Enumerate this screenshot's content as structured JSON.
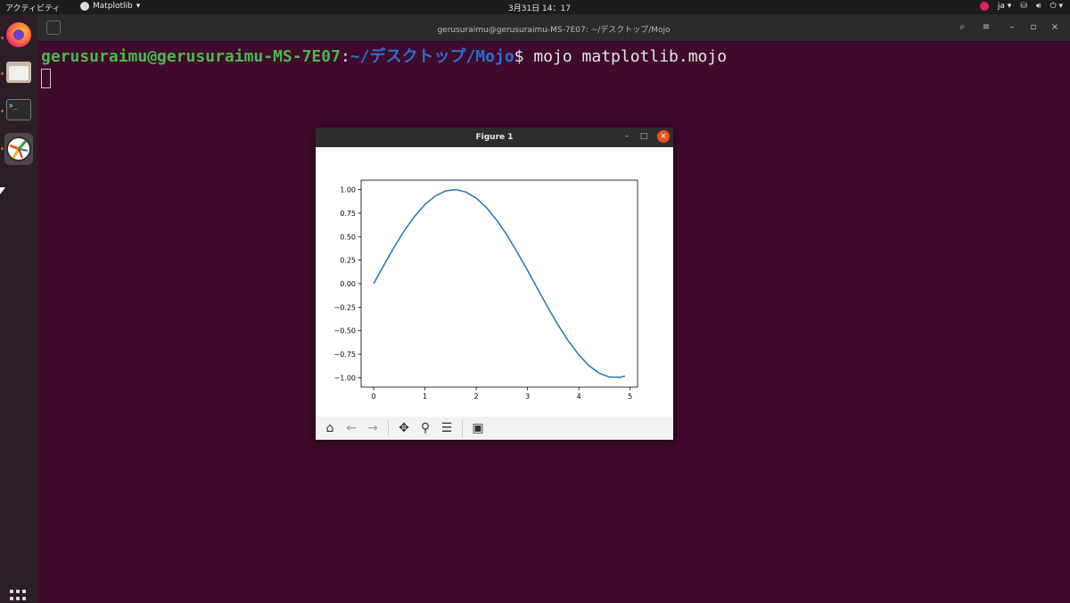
{
  "topbar": {
    "activities": "アクティビティ",
    "app_name": "Matplotlib",
    "clock": "3月31日 14：17",
    "lang": "ja"
  },
  "dock": {
    "items": [
      "firefox-icon",
      "files-icon",
      "terminal-icon",
      "matplotlib-icon"
    ],
    "show_apps": "apps-grid-icon"
  },
  "terminal": {
    "title": "gerusuraimu@gerusuraimu-MS-7E07: ~/デスクトップ/Mojo",
    "prompt_user": "gerusuraimu@gerusuraimu-MS-7E07",
    "prompt_colon": ":",
    "prompt_path": "~/デスクトップ/Mojo",
    "prompt_cmd": "$ mojo matplotlib.mojo"
  },
  "figure": {
    "title": "Figure 1",
    "toolbar": [
      "home-icon",
      "back-icon",
      "forward-icon",
      "pan-icon",
      "zoom-icon",
      "configure-subplots-icon",
      "save-icon"
    ]
  },
  "colors": {
    "line": "#1f77b4",
    "desktop": "#3c0a2a",
    "prompt_user": "#4bb84b",
    "prompt_path": "#2d6fcf"
  },
  "chart_data": {
    "type": "line",
    "title": "",
    "xlabel": "",
    "ylabel": "",
    "xlim": [
      -0.245,
      5.145
    ],
    "ylim": [
      -1.1,
      1.1
    ],
    "xticks": [
      0,
      1,
      2,
      3,
      4,
      5
    ],
    "xtick_labels": [
      "0",
      "1",
      "2",
      "3",
      "4",
      "5"
    ],
    "yticks": [
      1.0,
      0.75,
      0.5,
      0.25,
      0.0,
      -0.25,
      -0.5,
      -0.75,
      -1.0
    ],
    "ytick_labels": [
      "1.00",
      "0.75",
      "0.50",
      "0.25",
      "0.00",
      "−0.25",
      "−0.50",
      "−0.75",
      "−1.00"
    ],
    "grid": false,
    "series": [
      {
        "x": [
          0.0,
          0.2,
          0.4,
          0.6,
          0.8,
          1.0,
          1.2,
          1.4,
          1.6,
          1.8,
          2.0,
          2.2,
          2.4,
          2.6,
          2.8,
          3.0,
          3.2,
          3.4,
          3.6,
          3.8,
          4.0,
          4.2,
          4.4,
          4.6,
          4.8,
          4.9
        ],
        "y": [
          0.0,
          0.199,
          0.389,
          0.565,
          0.717,
          0.841,
          0.932,
          0.985,
          1.0,
          0.974,
          0.909,
          0.808,
          0.675,
          0.516,
          0.335,
          0.141,
          -0.058,
          -0.256,
          -0.443,
          -0.612,
          -0.757,
          -0.872,
          -0.952,
          -0.994,
          -0.996,
          -0.982
        ]
      }
    ]
  }
}
